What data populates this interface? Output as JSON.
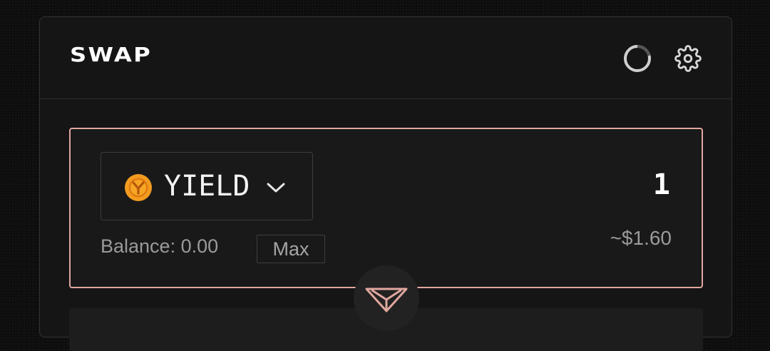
{
  "header": {
    "title": "SWAP",
    "refresh_icon": "loading-spinner-icon",
    "settings_icon": "gear-icon"
  },
  "from": {
    "token_symbol": "YIELD",
    "token_icon": "yield-token-icon",
    "amount": "1",
    "balance_text": "Balance: 0.00",
    "max_label": "Max",
    "usd_value": "~$1.60"
  },
  "swap_toggle_icon": "swap-direction-icon",
  "colors": {
    "accent": "#e0a79f",
    "background": "#0d0d0d",
    "card": "#151515",
    "token_orange": "#f29c1f"
  }
}
